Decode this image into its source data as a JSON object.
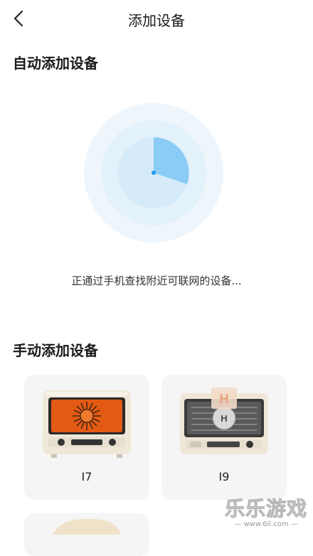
{
  "header": {
    "title": "添加设备"
  },
  "auto_section": {
    "title": "自动添加设备",
    "scan_status": "正通过手机查找附近可联网的设备..."
  },
  "manual_section": {
    "title": "手动添加设备",
    "devices": [
      {
        "label": "I7",
        "icon": "oven-i7-icon"
      },
      {
        "label": "I9",
        "icon": "oven-i9-icon"
      },
      {
        "label": "",
        "icon": "oven-icon"
      }
    ]
  },
  "colors": {
    "radar_outer": "#eef6fc",
    "radar_mid": "#e3f1fb",
    "radar_inner": "#d6ebf9",
    "radar_sweep": "#7cc7f5",
    "radar_dot": "#1e9be9",
    "card_bg": "#f5f5f5"
  },
  "watermark": {
    "main": "乐乐游戏",
    "sub": "— www.6ll.com —"
  }
}
